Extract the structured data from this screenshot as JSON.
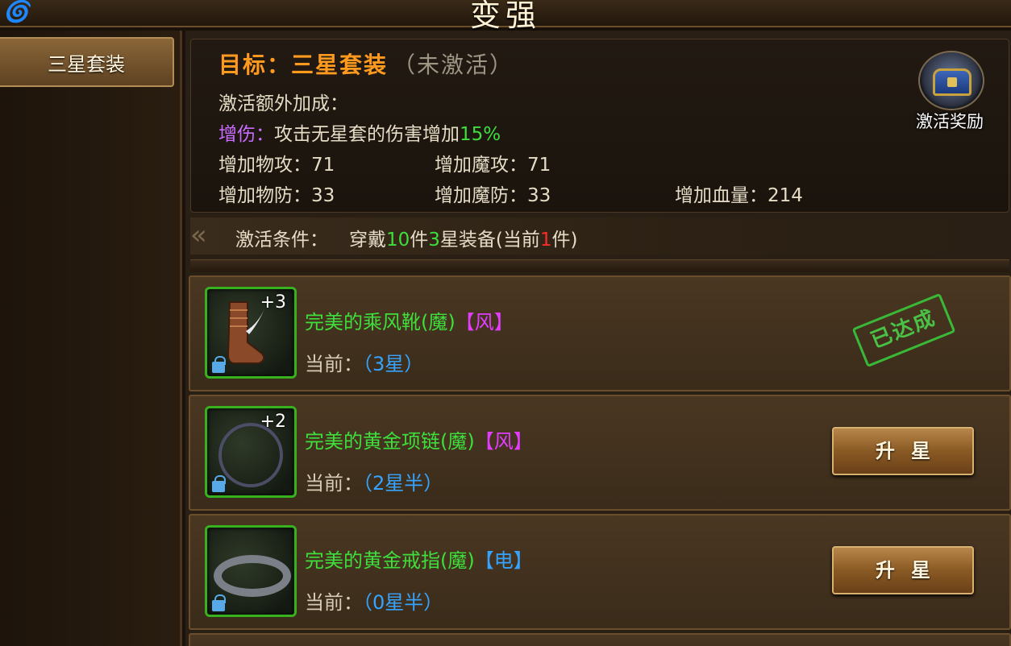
{
  "window": {
    "title": "变强",
    "logo": "🌀"
  },
  "sidebar": {
    "tabs": [
      {
        "label": "三星套装"
      }
    ]
  },
  "goal": {
    "prefix": "目标：",
    "name": "三星套装",
    "status": "（未激活）"
  },
  "bonus": {
    "heading": "激活额外加成：",
    "special_label": "增伤",
    "special_sep": "：",
    "special_text": "攻击无星套的伤害增加",
    "special_value": "15%",
    "stats": [
      {
        "label": "增加物攻：",
        "value": "71"
      },
      {
        "label": "增加魔攻：",
        "value": "71"
      },
      {
        "label": "增加物防：",
        "value": "33"
      },
      {
        "label": "增加魔防：",
        "value": "33"
      },
      {
        "label": "增加血量：",
        "value": "214"
      }
    ]
  },
  "reward": {
    "label": "激活奖励",
    "icon": "treasure-chest-icon"
  },
  "condition": {
    "label": "激活条件：",
    "p1": "穿戴",
    "count": "10",
    "p2": "件",
    "star": "3",
    "p3": "星装备(当前",
    "current": "1",
    "p4": "件)"
  },
  "items": [
    {
      "name": "完美的乘风靴(魔)",
      "attr": "【风】",
      "plus": "+3",
      "current_label": "当前：",
      "current_value": "（3星）",
      "state": "已达成",
      "icon": "boots-icon"
    },
    {
      "name": "完美的黄金项链(魔)",
      "attr": "【风】",
      "plus": "+2",
      "current_label": "当前：",
      "current_value": "（2星半）",
      "button": "升星",
      "icon": "necklace-icon"
    },
    {
      "name": "完美的黄金戒指(魔)",
      "attr": "【电】",
      "plus": "",
      "current_label": "当前：",
      "current_value": "（0星半）",
      "button": "升星",
      "icon": "ring-icon"
    }
  ],
  "colors": {
    "goal": "#ff9a1e",
    "green": "#3ede3c",
    "purple": "#c96bff",
    "blue": "#36a4ff",
    "red": "#ff2a2a"
  }
}
